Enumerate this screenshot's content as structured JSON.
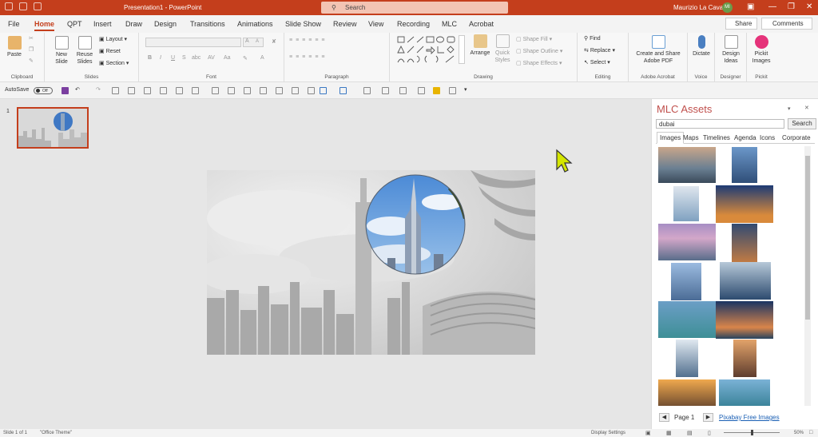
{
  "window": {
    "doc_title": "Presentation1 - PowerPoint",
    "search_placeholder": "Search",
    "user_name": "Maurizio La Cava",
    "user_initials": "MI"
  },
  "tabs": [
    "File",
    "Home",
    "QPT",
    "Insert",
    "Draw",
    "Design",
    "Transitions",
    "Animations",
    "Slide Show",
    "Review",
    "View",
    "Recording",
    "MLC",
    "Acrobat"
  ],
  "active_tab": "Home",
  "share_label": "Share",
  "comments_label": "Comments",
  "ribbon": {
    "clipboard": {
      "paste": "Paste",
      "group": "Clipboard"
    },
    "slides": {
      "new": "New",
      "new2": "Slide",
      "reuse": "Reuse",
      "reuse2": "Slides",
      "layout": "Layout",
      "reset": "Reset",
      "section": "Section",
      "group": "Slides"
    },
    "font": {
      "group": "Font",
      "bold": "B",
      "italic": "I",
      "underline": "U",
      "strike": "S",
      "shadow": "abc",
      "spacing": "AV",
      "case": "Aa",
      "grow": "A",
      "shrink": "A"
    },
    "paragraph": {
      "group": "Paragraph"
    },
    "drawing": {
      "arrange": "Arrange",
      "quick1": "Quick",
      "quick2": "Styles",
      "fill": "Shape Fill",
      "outline": "Shape Outline",
      "effects": "Shape Effects",
      "group": "Drawing"
    },
    "editing": {
      "find": "Find",
      "replace": "Replace",
      "select": "Select",
      "group": "Editing"
    },
    "acrobat": {
      "l1": "Create and Share",
      "l2": "Adobe PDF",
      "group": "Adobe Acrobat"
    },
    "voice": {
      "dictate": "Dictate",
      "group": "Voice"
    },
    "designer": {
      "l1": "Design",
      "l2": "Ideas",
      "group": "Designer"
    },
    "pickit": {
      "l1": "Pickit",
      "l2": "Images",
      "group": "Pickit"
    }
  },
  "qat": {
    "autosave": "AutoSave",
    "toggle": "Off"
  },
  "slide_number": "1",
  "panel": {
    "title": "MLC Assets",
    "search_value": "dubai",
    "search_button": "Search",
    "tabs": [
      "Images",
      "Maps",
      "Timelines",
      "Agenda",
      "Icons",
      "Corporate"
    ],
    "active_tab": "Images",
    "page_label": "Page 1",
    "pixabay_link": "Pixabay Free Images"
  },
  "status": {
    "slide": "Slide 1 of 1",
    "theme": "\"Office Theme\"",
    "display": "Display Settings",
    "zoom": "50%"
  }
}
